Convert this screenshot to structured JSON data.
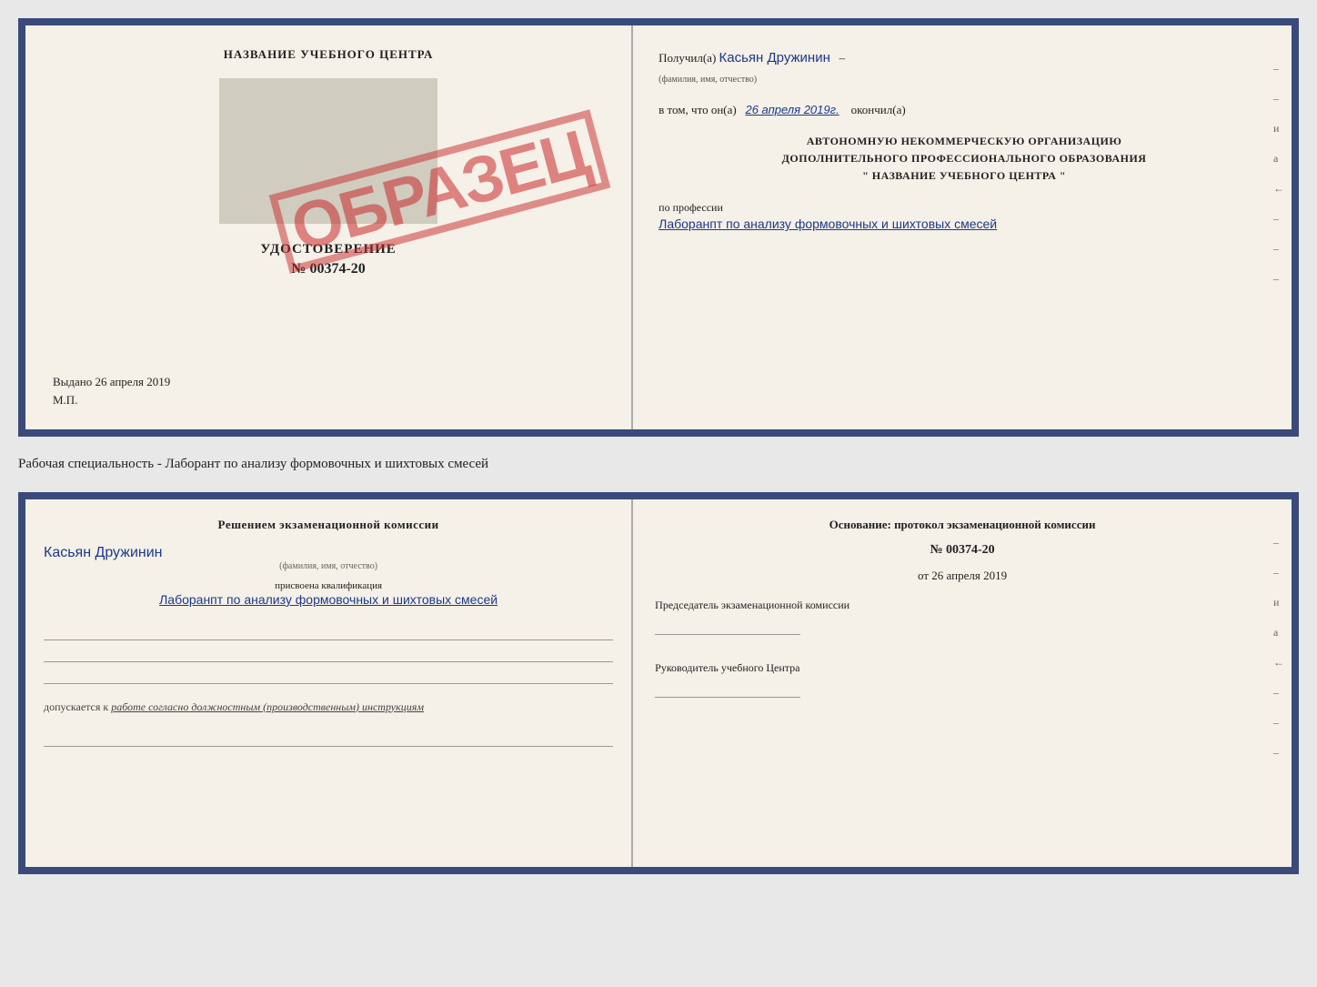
{
  "page": {
    "background_color": "#e8e8e8"
  },
  "top_document": {
    "left": {
      "title": "НАЗВАНИЕ УЧЕБНОГО ЦЕНТРА",
      "stamp_label": "УДОСТОВЕРЕНИЕ",
      "stamp_number": "№ 00374-20",
      "obrazec": "ОБРАЗЕЦ",
      "vydano": "Выдано 26 апреля 2019",
      "mp": "М.П."
    },
    "right": {
      "received_label": "Получил(а)",
      "received_name": "Касьян Дружинин",
      "fio_sublabel": "(фамилия, имя, отчество)",
      "vtom_label": "в том, что он(а)",
      "vtom_date": "26 апреля 2019г.",
      "okonchil": "окончил(а)",
      "org_line1": "АВТОНОМНУЮ НЕКОММЕРЧЕСКУЮ ОРГАНИЗАЦИЮ",
      "org_line2": "ДОПОЛНИТЕЛЬНОГО ПРОФЕССИОНАЛЬНОГО ОБРАЗОВАНИЯ",
      "org_line3": "\"  НАЗВАНИЕ УЧЕБНОГО ЦЕНТРА  \"",
      "profession_label": "по профессии",
      "profession_value": "Лаборанпт по анализу формовочных и шихтовых смесей",
      "side_labels": [
        "и",
        "а",
        "←",
        "–",
        "–",
        "–"
      ]
    }
  },
  "specialty_line": "Рабочая специальность - Лаборант по анализу формовочных и шихтовых смесей",
  "bottom_document": {
    "left": {
      "header": "Решением экзаменационной комиссии",
      "person_name": "Касьян Дружинин",
      "fio_sublabel": "(фамилия, имя, отчество)",
      "kvali_label": "присвоена квалификация",
      "kvali_value": "Лаборанпт по анализу формовочных и шихтовых смесей",
      "dopuskaetsya_prefix": "допускается к",
      "dopuskaetsya_value": "работе согласно должностным (производственным) инструкциям"
    },
    "right": {
      "osnov_label": "Основание: протокол экзаменационной комиссии",
      "protocol_number": "№ 00374-20",
      "date_prefix": "от",
      "date_value": "26 апреля 2019",
      "predsedatel_label": "Председатель экзаменационной комиссии",
      "rukovoditel_label": "Руководитель учебного Центра",
      "side_labels": [
        "и",
        "а",
        "←",
        "–",
        "–",
        "–"
      ]
    }
  }
}
